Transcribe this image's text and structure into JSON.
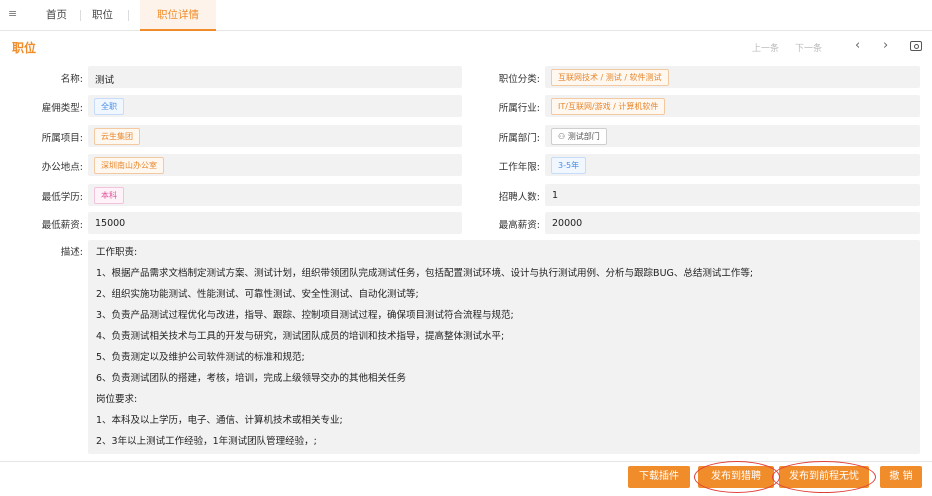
{
  "tabs": [
    {
      "label": "首页"
    },
    {
      "label": "职位"
    },
    {
      "label": "职位详情"
    }
  ],
  "header": {
    "title": "职位",
    "prev_label": "上一条",
    "next_label": "下一条"
  },
  "fields": {
    "name": {
      "label": "名称:",
      "value": "测试"
    },
    "category": {
      "label": "职位分类:",
      "value": "互联网技术 / 测试 / 软件测试"
    },
    "employment_type": {
      "label": "雇佣类型:",
      "value": "全职"
    },
    "industry": {
      "label": "所属行业:",
      "value": "IT/互联网/游戏 / 计算机软件"
    },
    "project": {
      "label": "所属项目:",
      "value": "云生集团"
    },
    "department": {
      "label": "所属部门:",
      "value": "测试部门"
    },
    "office": {
      "label": "办公地点:",
      "value": "深圳南山办公室"
    },
    "experience": {
      "label": "工作年限:",
      "value": "3-5年"
    },
    "education": {
      "label": "最低学历:",
      "value": "本科"
    },
    "headcount": {
      "label": "招聘人数:",
      "value": "1"
    },
    "min_salary": {
      "label": "最低薪资:",
      "value": "15000"
    },
    "max_salary": {
      "label": "最高薪资:",
      "value": "20000"
    }
  },
  "description": {
    "label": "描述:",
    "lines": [
      "工作职责:",
      "1、根据产品需求文档制定测试方案、测试计划，组织带领团队完成测试任务，包括配置测试环境、设计与执行测试用例、分析与跟踪BUG、总结测试工作等;",
      "2、组织实施功能测试、性能测试、可靠性测试、安全性测试、自动化测试等;",
      "3、负责产品测试过程优化与改进，指导、跟踪、控制项目测试过程，确保项目测试符合流程与规范;",
      "4、负责测试相关技术与工具的开发与研究，测试团队成员的培训和技术指导，提高整体测试水平;",
      "5、负责测定以及维护公司软件测试的标准和规范;",
      "6、负责测试团队的搭建，考核，培训，完成上级领导交办的其他相关任务",
      "岗位要求:",
      "1、本科及以上学历，电子、通信、计算机技术或相关专业;",
      "2、3年以上测试工作经验，1年测试团队管理经验，;"
    ]
  },
  "footer": {
    "download_label": "下载插件",
    "publish_liepin_label": "发布到猎聘",
    "publish_qiancheng_label": "发布到前程无忧",
    "cancel_label": "撤 销"
  },
  "colors": {
    "accent": "#f08c2a",
    "annotation": "#e0403a"
  }
}
